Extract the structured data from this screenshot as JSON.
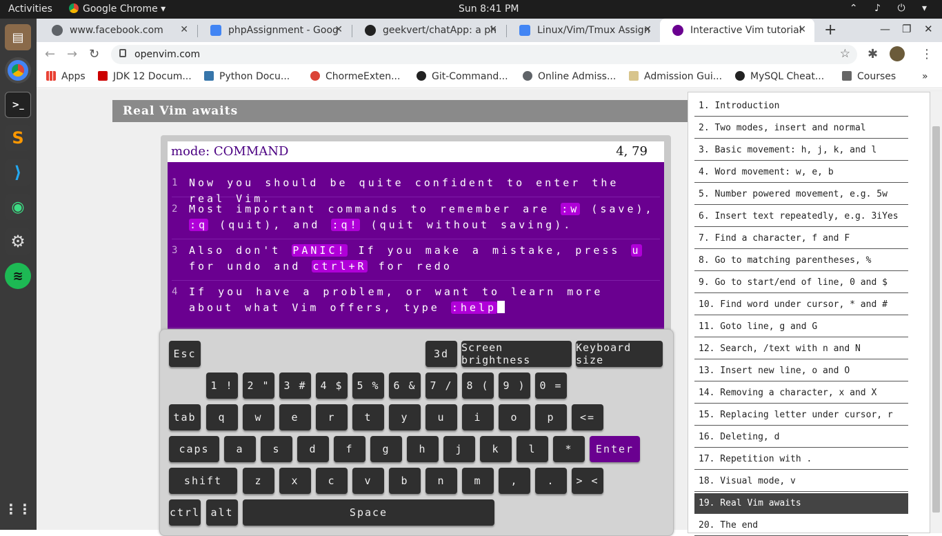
{
  "topbar": {
    "activities": "Activities",
    "app": "Google Chrome ▾",
    "clock": "Sun  8:41 PM",
    "tray": "⌃ ♪ ⏻ ▾"
  },
  "tabs": [
    {
      "title": "www.facebook.com",
      "color": "#5f6368"
    },
    {
      "title": "phpAssignment - Goog",
      "color": "#4285f4"
    },
    {
      "title": "geekvert/chatApp: a ph",
      "color": "#222222"
    },
    {
      "title": "Linux/Vim/Tmux Assign",
      "color": "#4285f4"
    },
    {
      "title": "Interactive Vim tutorial",
      "color": "#6a0090"
    }
  ],
  "toolbar": {
    "url": "openvim.com"
  },
  "bookmarks": [
    "Apps",
    "JDK 12 Docum...",
    "Python Docu...",
    "ChormeExten...",
    "Git-Command...",
    "Online Admiss...",
    "Admission Gui...",
    "MySQL Cheat...",
    "Courses",
    "»"
  ],
  "page": {
    "heading": "Real Vim awaits"
  },
  "editor": {
    "mode": "mode: COMMAND",
    "position": "4, 79",
    "lines": [
      {
        "num": "1",
        "parts": [
          "Now you should be quite confident to enter the real Vim."
        ]
      },
      {
        "num": "2",
        "parts": [
          "Most important commands to remember are ",
          ":w",
          " (save), ",
          ":q",
          " (quit), and ",
          ":q!",
          " (quit without saving)."
        ]
      },
      {
        "num": "3",
        "parts": [
          "Also don't ",
          "PANIC!",
          " If you make a mistake, press ",
          "u",
          " for undo and ",
          "ctrl+R",
          " for redo"
        ]
      },
      {
        "num": "4",
        "parts": [
          "If you have a problem, or want to learn more about what Vim offers, type ",
          ":help"
        ]
      }
    ]
  },
  "keyboard": {
    "row0": [
      "Esc",
      "3d",
      "Screen brightness",
      "Keyboard size"
    ],
    "row1": [
      "1 !",
      "2 \"",
      "3 #",
      "4 $",
      "5 %",
      "6 &",
      "7 /",
      "8 (",
      "9 )",
      "0 ="
    ],
    "row2": [
      "tab",
      "q",
      "w",
      "e",
      "r",
      "t",
      "y",
      "u",
      "i",
      "o",
      "p",
      "<="
    ],
    "row3": [
      "caps",
      "a",
      "s",
      "d",
      "f",
      "g",
      "h",
      "j",
      "k",
      "l",
      "*",
      "Enter"
    ],
    "row4": [
      "shift",
      "z",
      "x",
      "c",
      "v",
      "b",
      "n",
      "m",
      ",",
      ".",
      "> <"
    ],
    "row5": [
      "ctrl",
      "alt",
      "Space"
    ]
  },
  "lessons": [
    "1. Introduction",
    "2. Two modes, insert and normal",
    "3. Basic movement: h, j, k, and l",
    "4. Word movement: w, e, b",
    "5. Number powered movement, e.g. 5w",
    "6. Insert text repeatedly, e.g. 3iYes",
    "7. Find a character, f and F",
    "8. Go to matching parentheses, %",
    "9. Go to start/end of line, 0 and $",
    "10. Find word under cursor, * and #",
    "11. Goto line, g and G",
    "12. Search, /text with n and N",
    "13. Insert new line, o and O",
    "14. Removing a character, x and X",
    "15. Replacing letter under cursor, r",
    "16. Deleting, d",
    "17. Repetition with .",
    "18. Visual mode, v",
    "19. Real Vim awaits",
    "20. The end"
  ],
  "active_lesson": 18
}
